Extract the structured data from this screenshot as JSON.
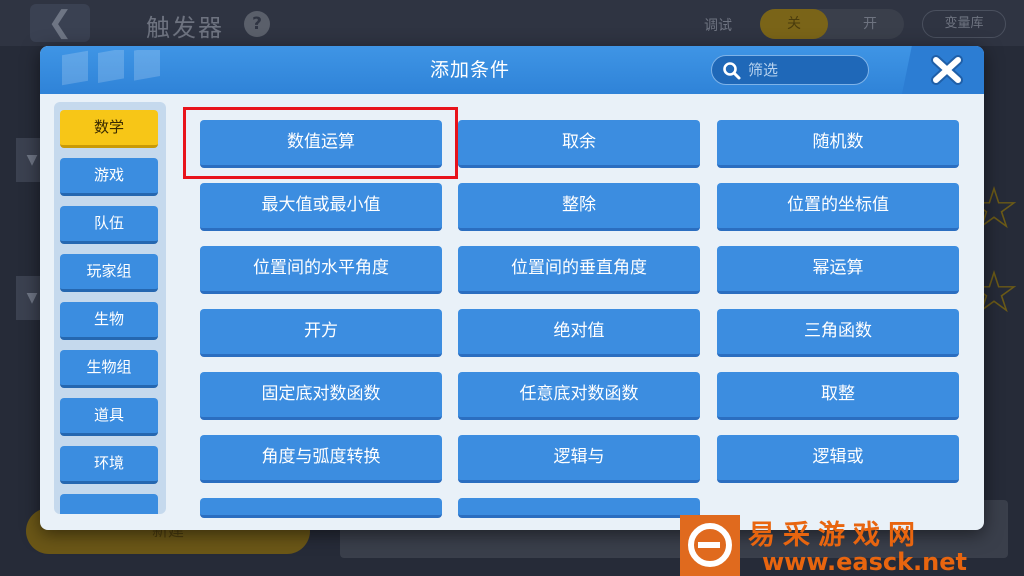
{
  "background": {
    "title": "触发器",
    "help_icon": "?",
    "debug_label": "调试",
    "toggle_off": "关",
    "toggle_on": "开",
    "variable_library": "变量库",
    "new_button": "新建"
  },
  "dialog": {
    "title": "添加条件",
    "filter_placeholder": "筛选",
    "categories": [
      {
        "label": "数学",
        "active": true
      },
      {
        "label": "游戏"
      },
      {
        "label": "队伍"
      },
      {
        "label": "玩家组"
      },
      {
        "label": "生物"
      },
      {
        "label": "生物组"
      },
      {
        "label": "道具"
      },
      {
        "label": "环境"
      }
    ],
    "conditions": [
      "数值运算",
      "取余",
      "随机数",
      "最大值或最小值",
      "整除",
      "位置的坐标值",
      "位置间的水平角度",
      "位置间的垂直角度",
      "幂运算",
      "开方",
      "绝对值",
      "三角函数",
      "固定底对数函数",
      "任意底对数函数",
      "取整",
      "角度与弧度转换",
      "逻辑与",
      "逻辑或"
    ]
  },
  "watermark": {
    "name": "易采游戏网",
    "url": "www.easck.net"
  },
  "colors": {
    "header_blue": "#3f95e5",
    "button_blue": "#3c8de0",
    "active_yellow": "#f7c617",
    "highlight_red": "#e8131b",
    "watermark_orange": "#e8650f"
  }
}
